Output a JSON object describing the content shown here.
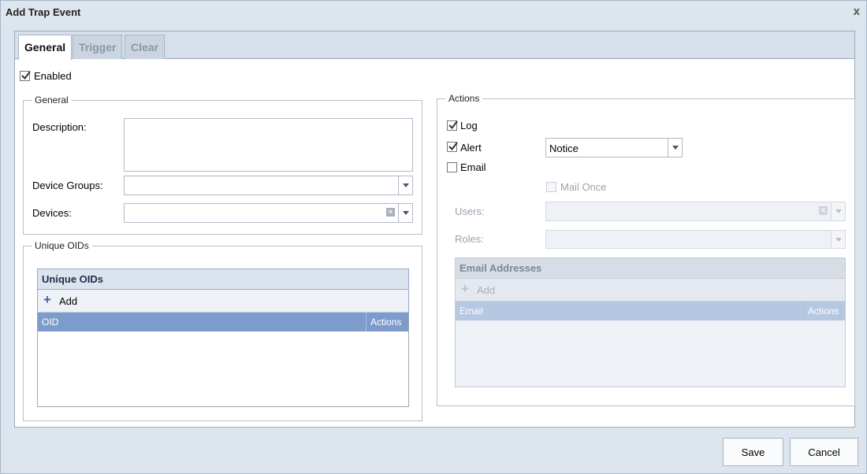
{
  "window": {
    "title": "Add Trap Event",
    "close_glyph": "x"
  },
  "tabs": [
    {
      "label": "General",
      "active": true
    },
    {
      "label": "Trigger",
      "active": false
    },
    {
      "label": "Clear",
      "active": false
    }
  ],
  "enabled": {
    "label": "Enabled",
    "checked": true
  },
  "general_section": {
    "legend": "General",
    "description_label": "Description:",
    "description_value": "",
    "device_groups_label": "Device Groups:",
    "device_groups_value": "",
    "devices_label": "Devices:",
    "devices_value": ""
  },
  "unique_oids_section": {
    "legend": "Unique OIDs",
    "grid_title": "Unique OIDs",
    "add_label": "Add",
    "columns": [
      "OID",
      "Actions"
    ],
    "rows": []
  },
  "actions_section": {
    "legend": "Actions",
    "log": {
      "label": "Log",
      "checked": true
    },
    "alert": {
      "label": "Alert",
      "checked": true,
      "level": "Notice"
    },
    "email": {
      "label": "Email",
      "checked": false
    },
    "mail_once": {
      "label": "Mail Once",
      "checked": false,
      "disabled": true
    },
    "users_label": "Users:",
    "users_value": "",
    "roles_label": "Roles:",
    "roles_value": "",
    "email_grid": {
      "title": "Email Addresses",
      "add_label": "Add",
      "columns": [
        "Email",
        "Actions"
      ],
      "rows": []
    }
  },
  "footer": {
    "save_label": "Save",
    "cancel_label": "Cancel"
  },
  "colors": {
    "grid_header": "#7d9ccc",
    "window_bg": "#dce4ee",
    "accent": "#3a67a8"
  }
}
